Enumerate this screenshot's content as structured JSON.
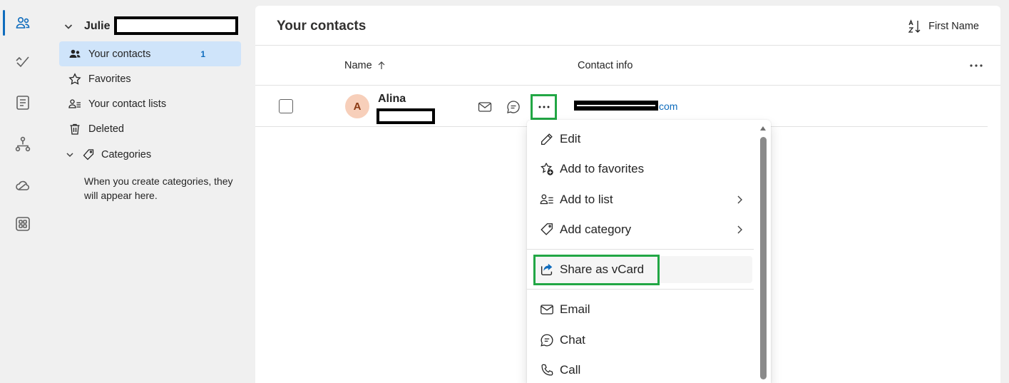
{
  "account": {
    "name": "Julie"
  },
  "nav": [
    {
      "label": "Your contacts",
      "count": "1"
    },
    {
      "label": "Favorites"
    },
    {
      "label": "Your contact lists"
    },
    {
      "label": "Deleted"
    }
  ],
  "categories": {
    "label": "Categories",
    "note": "When you create categories, they will appear here."
  },
  "main": {
    "title": "Your contacts",
    "sort_label": "First Name",
    "columns": {
      "name": "Name",
      "info": "Contact info"
    }
  },
  "contact": {
    "initial": "A",
    "name": "Alina",
    "email_tail": "com"
  },
  "menu": {
    "items": [
      {
        "label": "Edit",
        "icon": "pencil-icon"
      },
      {
        "label": "Add to favorites",
        "icon": "star-add-icon"
      },
      {
        "label": "Add to list",
        "icon": "people-list-icon",
        "submenu": true
      },
      {
        "label": "Add category",
        "icon": "tag-icon",
        "submenu": true
      },
      {
        "label": "Share as vCard",
        "icon": "share-icon"
      },
      {
        "label": "Email",
        "icon": "mail-icon"
      },
      {
        "label": "Chat",
        "icon": "chat-icon"
      },
      {
        "label": "Call",
        "icon": "phone-icon"
      }
    ]
  },
  "colors": {
    "accent": "#0f6cbd",
    "highlight": "#22a745",
    "selected": "#cfe4fa"
  }
}
